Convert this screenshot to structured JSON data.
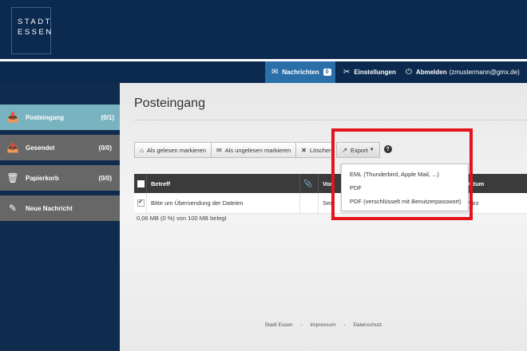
{
  "logo": {
    "line1": "STADT",
    "line2": "ESSEN"
  },
  "navbar": {
    "messages_label": "Nachrichten",
    "messages_count": "0",
    "settings_label": "Einstellungen",
    "logout_label": "Abmelden",
    "logout_user": "(zmustermann@gmx.de)"
  },
  "sidebar": {
    "items": [
      {
        "label": "Posteingang",
        "count": "(0/1)"
      },
      {
        "label": "Gesendet",
        "count": "(0/0)"
      },
      {
        "label": "Papierkorb",
        "count": "(0/0)"
      },
      {
        "label": "Neue Nachricht",
        "count": ""
      }
    ]
  },
  "main": {
    "title": "Posteingang",
    "toolbar": {
      "mark_read": "Als gelesen markieren",
      "mark_unread": "Als ungelesen markieren",
      "delete": "Löschen",
      "export": "Export",
      "help_icon": "?"
    },
    "table": {
      "headers": {
        "subject": "Betreff",
        "from": "Von",
        "date": "Datum"
      },
      "rows": [
        {
          "subject": "Bitte um Übersendung der Dateien",
          "from": "Secr",
          "date": "März",
          "checked": true
        }
      ]
    },
    "usage": "0,06 MB (0 %) von 100 MB belegt",
    "export_menu": [
      "EML (Thunderbird, Apple Mail, ...)",
      "PDF",
      "PDF (verschlüsselt mit Benutzerpasswort)"
    ]
  },
  "footer": {
    "links": [
      "Stadt Essen",
      "Impressum",
      "Datenschutz"
    ],
    "separator": "-"
  },
  "colors": {
    "header_bg": "#0c2a4f",
    "active_nav": "#2a6fa8",
    "active_sidebar": "#7ab3c0",
    "sidebar_item": "#676767",
    "highlight_box": "#e3141b"
  }
}
